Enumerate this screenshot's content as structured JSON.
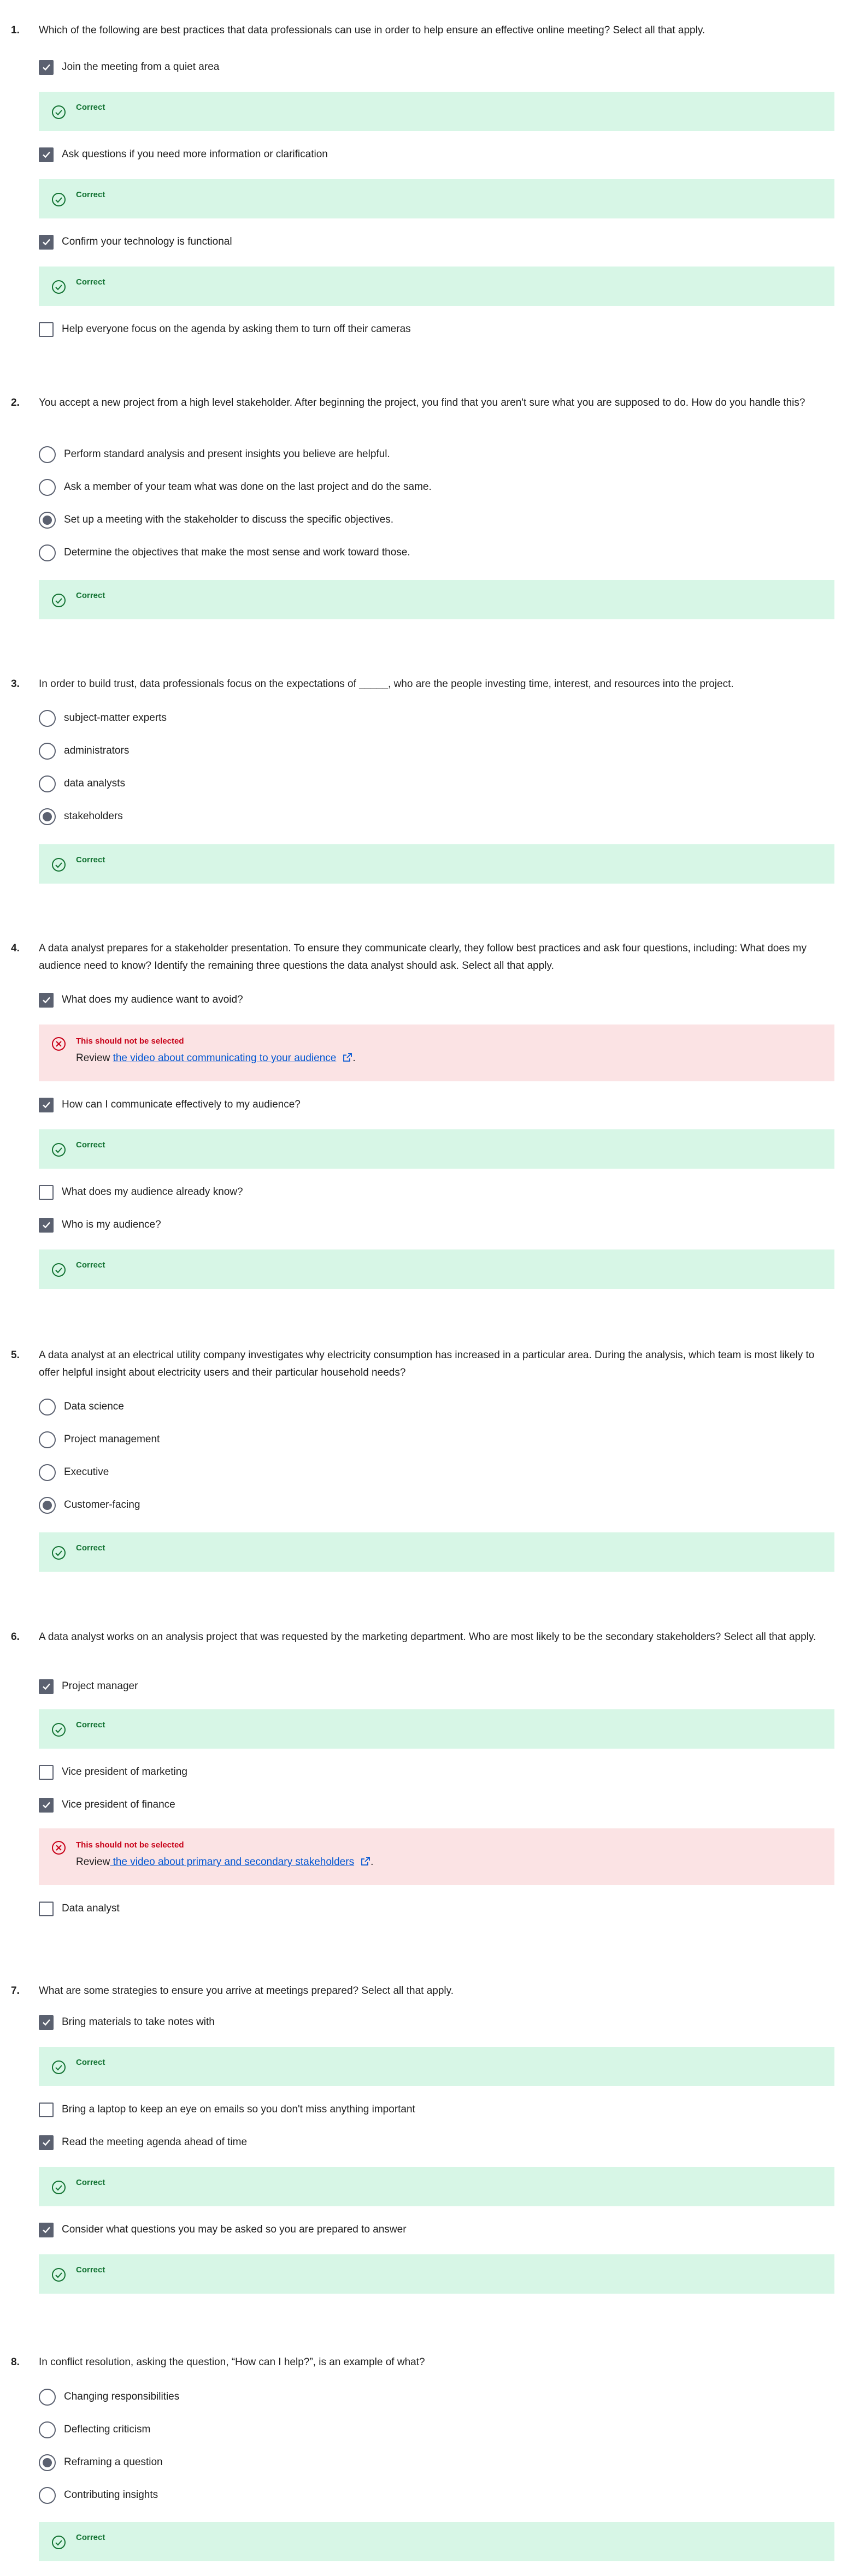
{
  "questions": [
    {
      "number": "1.",
      "text": "Which of the following are best practices that data professionals can use in order to help ensure an effective online meeting? Select all that apply.",
      "options": [
        {
          "label": "Join the meeting from a quiet area",
          "checked": true
        },
        {
          "label": "Ask questions if you need more information or clarification",
          "checked": true
        },
        {
          "label": "Confirm your technology is functional",
          "checked": true
        },
        {
          "label": "Help everyone focus on the agenda by asking them to turn off their cameras",
          "checked": false
        }
      ],
      "feedback": [
        {
          "title": "Correct"
        },
        {
          "title": "Correct"
        },
        {
          "title": "Correct"
        }
      ]
    },
    {
      "number": "2.",
      "text": "You accept a new project from a high level stakeholder. After beginning the project, you find that you aren't sure what you are supposed to do. How do you handle this?",
      "options": [
        {
          "label": "Perform standard analysis and present insights you believe are helpful.",
          "selected": false
        },
        {
          "label": "Ask a member of your team what was done on the last project and do the same.",
          "selected": false
        },
        {
          "label": "Set up a meeting with the stakeholder to discuss the specific objectives.",
          "selected": true
        },
        {
          "label": "Determine the objectives that make the most sense and work toward those.",
          "selected": false
        }
      ],
      "feedback": [
        {
          "title": "Correct"
        }
      ]
    },
    {
      "number": "3.",
      "text": "In order to build trust, data professionals focus on the expectations of _____, who are the people investing time, interest, and resources into the project.",
      "options": [
        {
          "label": "subject-matter experts",
          "selected": false
        },
        {
          "label": "administrators",
          "selected": false
        },
        {
          "label": "data analysts",
          "selected": false
        },
        {
          "label": "stakeholders",
          "selected": true
        }
      ],
      "feedback": [
        {
          "title": "Correct"
        }
      ]
    },
    {
      "number": "4.",
      "text": "A data analyst prepares for a stakeholder presentation. To ensure they communicate clearly, they follow best practices and ask four questions, including: What does my audience need to know? Identify the remaining three questions the data analyst should ask. Select all that apply.",
      "options": [
        {
          "label": "What does my audience want to avoid?",
          "checked": true
        },
        {
          "label": "How can I communicate effectively to my audience?",
          "checked": true
        },
        {
          "label": "What does my audience already know?",
          "checked": false
        },
        {
          "label": "Who is my audience?",
          "checked": true
        }
      ],
      "feedback": [
        {
          "title": "This should not be selected",
          "review_prefix": "Review ",
          "link": "the video about communicating to your audience",
          "suffix": "."
        },
        {
          "title": "Correct"
        },
        {
          "title": "Correct"
        }
      ]
    },
    {
      "number": "5.",
      "text": "A data analyst at an electrical utility company investigates why electricity consumption has increased in a particular area. During the analysis, which team is most likely to offer helpful insight about electricity users and their particular household needs?",
      "options": [
        {
          "label": "Data science",
          "selected": false
        },
        {
          "label": "Project management",
          "selected": false
        },
        {
          "label": "Executive",
          "selected": false
        },
        {
          "label": "Customer-facing",
          "selected": true
        }
      ],
      "feedback": [
        {
          "title": "Correct"
        }
      ]
    },
    {
      "number": "6.",
      "text": "A data analyst works on an analysis project that was requested by the marketing department. Who are most likely to be the secondary stakeholders? Select all that apply.",
      "options": [
        {
          "label": "Project manager",
          "checked": true
        },
        {
          "label": "Vice president of marketing",
          "checked": false
        },
        {
          "label": "Vice president of finance",
          "checked": true
        },
        {
          "label": "Data analyst",
          "checked": false
        }
      ],
      "feedback": [
        {
          "title": "Correct"
        },
        {
          "title": "This should not be selected",
          "review_prefix": "Review",
          "link": " the video about primary and secondary stakeholders",
          "suffix": "."
        }
      ]
    },
    {
      "number": "7.",
      "text": "What are some strategies to ensure you arrive at meetings prepared? Select all that apply.",
      "options": [
        {
          "label": "Bring materials to take notes with",
          "checked": true
        },
        {
          "label": "Bring a laptop to keep an eye on emails so you don't miss anything important",
          "checked": false
        },
        {
          "label": "Read the meeting agenda ahead of time",
          "checked": true
        },
        {
          "label": "Consider what questions you may be asked so you are prepared to answer",
          "checked": true
        }
      ],
      "feedback": [
        {
          "title": "Correct"
        },
        {
          "title": "Correct"
        },
        {
          "title": "Correct"
        }
      ]
    },
    {
      "number": "8.",
      "text": "In conflict resolution, asking the question, “How can I help?”, is an example of what?",
      "options": [
        {
          "label": "Changing responsibilities",
          "selected": false
        },
        {
          "label": "Deflecting criticism",
          "selected": false
        },
        {
          "label": "Reframing a question",
          "selected": true
        },
        {
          "label": "Contributing insights",
          "selected": false
        }
      ],
      "feedback": [
        {
          "title": "Correct"
        }
      ]
    }
  ],
  "colors": {
    "control": "#5b6170",
    "correct_bg": "#d7f6e6",
    "correct_text": "#137333",
    "incorrect_bg": "#fbe3e4",
    "incorrect_text": "#c70017",
    "link": "#0056d2"
  },
  "icons": {
    "correct": "check-circle-icon",
    "incorrect": "x-circle-icon",
    "external_link": "external-link-icon",
    "checkbox": "checkmark-icon"
  }
}
